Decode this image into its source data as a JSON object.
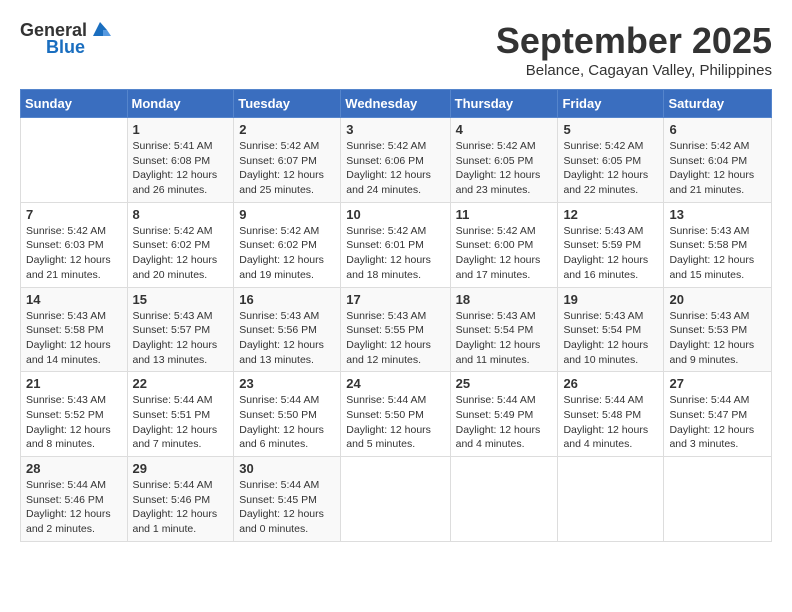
{
  "header": {
    "logo_general": "General",
    "logo_blue": "Blue",
    "month_title": "September 2025",
    "subtitle": "Belance, Cagayan Valley, Philippines"
  },
  "days_of_week": [
    "Sunday",
    "Monday",
    "Tuesday",
    "Wednesday",
    "Thursday",
    "Friday",
    "Saturday"
  ],
  "weeks": [
    [
      {
        "day": "",
        "info": ""
      },
      {
        "day": "1",
        "info": "Sunrise: 5:41 AM\nSunset: 6:08 PM\nDaylight: 12 hours\nand 26 minutes."
      },
      {
        "day": "2",
        "info": "Sunrise: 5:42 AM\nSunset: 6:07 PM\nDaylight: 12 hours\nand 25 minutes."
      },
      {
        "day": "3",
        "info": "Sunrise: 5:42 AM\nSunset: 6:06 PM\nDaylight: 12 hours\nand 24 minutes."
      },
      {
        "day": "4",
        "info": "Sunrise: 5:42 AM\nSunset: 6:05 PM\nDaylight: 12 hours\nand 23 minutes."
      },
      {
        "day": "5",
        "info": "Sunrise: 5:42 AM\nSunset: 6:05 PM\nDaylight: 12 hours\nand 22 minutes."
      },
      {
        "day": "6",
        "info": "Sunrise: 5:42 AM\nSunset: 6:04 PM\nDaylight: 12 hours\nand 21 minutes."
      }
    ],
    [
      {
        "day": "7",
        "info": "Sunrise: 5:42 AM\nSunset: 6:03 PM\nDaylight: 12 hours\nand 21 minutes."
      },
      {
        "day": "8",
        "info": "Sunrise: 5:42 AM\nSunset: 6:02 PM\nDaylight: 12 hours\nand 20 minutes."
      },
      {
        "day": "9",
        "info": "Sunrise: 5:42 AM\nSunset: 6:02 PM\nDaylight: 12 hours\nand 19 minutes."
      },
      {
        "day": "10",
        "info": "Sunrise: 5:42 AM\nSunset: 6:01 PM\nDaylight: 12 hours\nand 18 minutes."
      },
      {
        "day": "11",
        "info": "Sunrise: 5:42 AM\nSunset: 6:00 PM\nDaylight: 12 hours\nand 17 minutes."
      },
      {
        "day": "12",
        "info": "Sunrise: 5:43 AM\nSunset: 5:59 PM\nDaylight: 12 hours\nand 16 minutes."
      },
      {
        "day": "13",
        "info": "Sunrise: 5:43 AM\nSunset: 5:58 PM\nDaylight: 12 hours\nand 15 minutes."
      }
    ],
    [
      {
        "day": "14",
        "info": "Sunrise: 5:43 AM\nSunset: 5:58 PM\nDaylight: 12 hours\nand 14 minutes."
      },
      {
        "day": "15",
        "info": "Sunrise: 5:43 AM\nSunset: 5:57 PM\nDaylight: 12 hours\nand 13 minutes."
      },
      {
        "day": "16",
        "info": "Sunrise: 5:43 AM\nSunset: 5:56 PM\nDaylight: 12 hours\nand 13 minutes."
      },
      {
        "day": "17",
        "info": "Sunrise: 5:43 AM\nSunset: 5:55 PM\nDaylight: 12 hours\nand 12 minutes."
      },
      {
        "day": "18",
        "info": "Sunrise: 5:43 AM\nSunset: 5:54 PM\nDaylight: 12 hours\nand 11 minutes."
      },
      {
        "day": "19",
        "info": "Sunrise: 5:43 AM\nSunset: 5:54 PM\nDaylight: 12 hours\nand 10 minutes."
      },
      {
        "day": "20",
        "info": "Sunrise: 5:43 AM\nSunset: 5:53 PM\nDaylight: 12 hours\nand 9 minutes."
      }
    ],
    [
      {
        "day": "21",
        "info": "Sunrise: 5:43 AM\nSunset: 5:52 PM\nDaylight: 12 hours\nand 8 minutes."
      },
      {
        "day": "22",
        "info": "Sunrise: 5:44 AM\nSunset: 5:51 PM\nDaylight: 12 hours\nand 7 minutes."
      },
      {
        "day": "23",
        "info": "Sunrise: 5:44 AM\nSunset: 5:50 PM\nDaylight: 12 hours\nand 6 minutes."
      },
      {
        "day": "24",
        "info": "Sunrise: 5:44 AM\nSunset: 5:50 PM\nDaylight: 12 hours\nand 5 minutes."
      },
      {
        "day": "25",
        "info": "Sunrise: 5:44 AM\nSunset: 5:49 PM\nDaylight: 12 hours\nand 4 minutes."
      },
      {
        "day": "26",
        "info": "Sunrise: 5:44 AM\nSunset: 5:48 PM\nDaylight: 12 hours\nand 4 minutes."
      },
      {
        "day": "27",
        "info": "Sunrise: 5:44 AM\nSunset: 5:47 PM\nDaylight: 12 hours\nand 3 minutes."
      }
    ],
    [
      {
        "day": "28",
        "info": "Sunrise: 5:44 AM\nSunset: 5:46 PM\nDaylight: 12 hours\nand 2 minutes."
      },
      {
        "day": "29",
        "info": "Sunrise: 5:44 AM\nSunset: 5:46 PM\nDaylight: 12 hours\nand 1 minute."
      },
      {
        "day": "30",
        "info": "Sunrise: 5:44 AM\nSunset: 5:45 PM\nDaylight: 12 hours\nand 0 minutes."
      },
      {
        "day": "",
        "info": ""
      },
      {
        "day": "",
        "info": ""
      },
      {
        "day": "",
        "info": ""
      },
      {
        "day": "",
        "info": ""
      }
    ]
  ]
}
